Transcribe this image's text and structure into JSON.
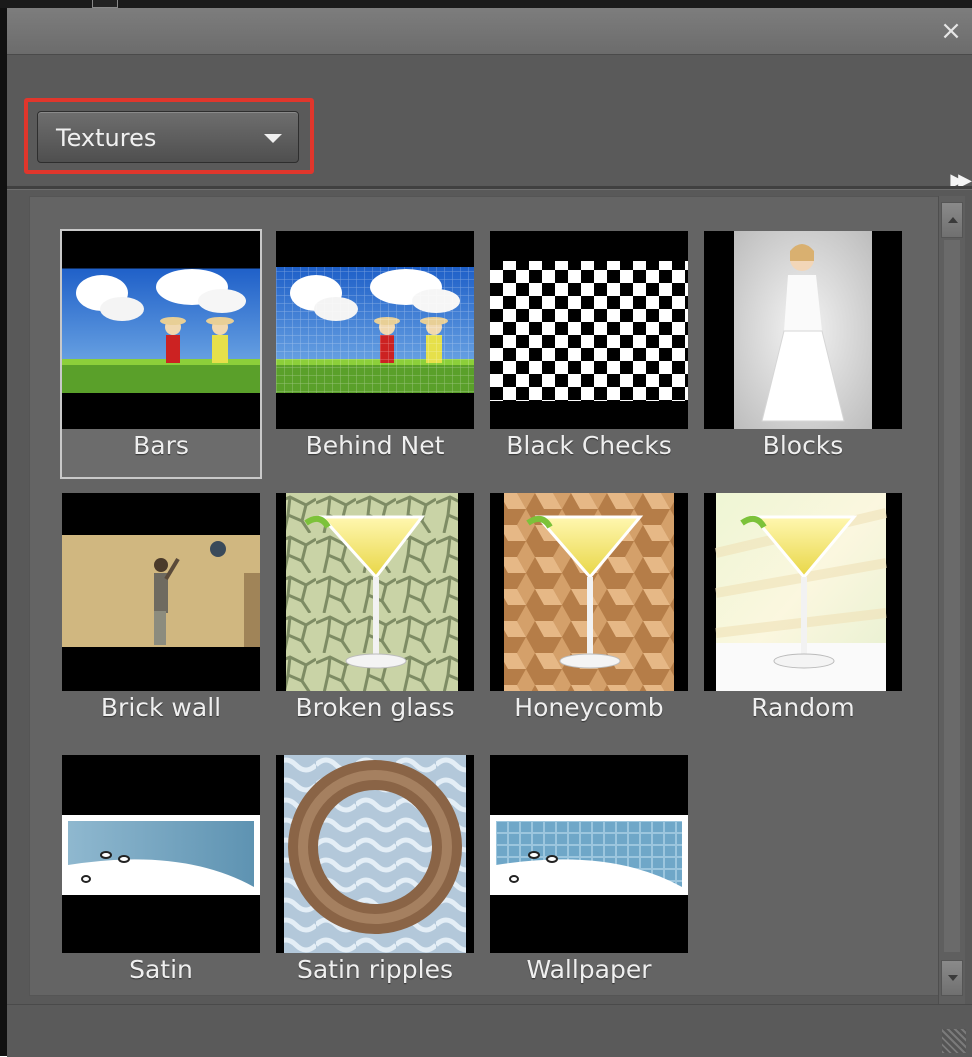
{
  "panel": {
    "close_icon": "close-icon",
    "more_icon": "double-chevron-right-icon"
  },
  "dropdown": {
    "value": "Textures",
    "icon": "chevron-down-icon"
  },
  "items": [
    {
      "label": "Bars",
      "selected": true
    },
    {
      "label": "Behind Net",
      "selected": false
    },
    {
      "label": "Black Checks",
      "selected": false
    },
    {
      "label": "Blocks",
      "selected": false
    },
    {
      "label": "Brick wall",
      "selected": false
    },
    {
      "label": "Broken glass",
      "selected": false
    },
    {
      "label": "Honeycomb",
      "selected": false
    },
    {
      "label": "Random",
      "selected": false
    },
    {
      "label": "Satin",
      "selected": false
    },
    {
      "label": "Satin ripples",
      "selected": false
    },
    {
      "label": "Wallpaper",
      "selected": false
    }
  ],
  "colors": {
    "highlight": "#e0362c",
    "panel": "#595959"
  }
}
